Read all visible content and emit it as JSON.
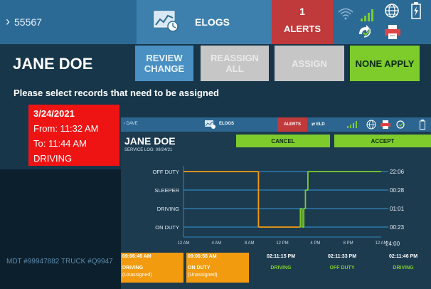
{
  "topbar": {
    "vehicle": "55567",
    "app_label": "ELOGS",
    "alerts_count": "1",
    "alerts_label": "ALERTS",
    "icons": [
      "wifi-icon",
      "signal-icon",
      "globe-icon",
      "battery-icon",
      "sync-icon",
      "printer-icon"
    ]
  },
  "main": {
    "driver_name": "JANE DOE",
    "buttons": {
      "review_line1": "REVIEW",
      "review_line2": "CHANGE",
      "reassign_all": "REASSIGN ALL",
      "assign": "ASSIGN",
      "none_apply": "NONE APPLY"
    },
    "instruction": "Please select records that need to be assigned",
    "record": {
      "date": "3/24/2021",
      "from": "From: 11:32 AM",
      "to": "To: 11:44 AM",
      "status": "DRIVING"
    },
    "footer": "MDT #99947882    TRUCK #Q9947"
  },
  "overlay": {
    "vehicle": "DAVE",
    "app_label": "ELOGS",
    "alerts_label": "ALERTS",
    "eld_label": "ELD",
    "driver_name": "JANE DOE",
    "service_log": "SERVICE LOG: 09/24/21",
    "cancel": "CANCEL",
    "accept": "ACCEPT",
    "records": [
      {
        "time": "09:06:46 AM",
        "status": "DRIVING",
        "sub": "(Unassigned)",
        "assigned": true
      },
      {
        "time": "09:06:56 AM",
        "status": "ON DUTY",
        "sub": "(Unassigned)",
        "assigned": true
      },
      {
        "time": "02:11:15 PM",
        "status": "DRIVING",
        "sub": "",
        "assigned": false
      },
      {
        "time": "02:11:33 PM",
        "status": "OFF DUTY",
        "sub": "",
        "assigned": false
      },
      {
        "time": "02:11:46 PM",
        "status": "DRIVING",
        "sub": "",
        "assigned": false
      }
    ]
  },
  "chart_data": {
    "type": "line",
    "title": "",
    "xlabel": "",
    "ylabel": "",
    "rows": [
      "OFF DUTY",
      "SLEEPER",
      "DRIVING",
      "ON DUTY"
    ],
    "row_totals": [
      "22:06",
      "00:28",
      "01:01",
      "00:23"
    ],
    "total": "24:00",
    "x_ticks": [
      "12 AM",
      "4 AM",
      "8 AM",
      "12 PM",
      "4 PM",
      "8 PM",
      "12 AM"
    ],
    "xlim_hours": [
      0,
      24
    ],
    "series": [
      {
        "color": "#f39b0f",
        "segments": [
          {
            "row": "OFF DUTY",
            "from": 0,
            "to": 9.1
          },
          {
            "row": "ON DUTY",
            "from": 9.1,
            "to": 14.19
          }
        ],
        "transitions": [
          9.1
        ]
      },
      {
        "color": "#7dcc2c",
        "segments": [
          {
            "row": "DRIVING",
            "from": 14.19,
            "to": 14.4
          },
          {
            "row": "ON DUTY",
            "from": 14.4,
            "to": 14.6
          },
          {
            "row": "DRIVING",
            "from": 14.6,
            "to": 14.8
          },
          {
            "row": "SLEEPER",
            "from": 14.8,
            "to": 15.1
          },
          {
            "row": "OFF DUTY",
            "from": 15.1,
            "to": 24
          }
        ],
        "transitions": [
          14.19,
          14.4,
          14.6,
          14.8,
          15.1
        ]
      }
    ]
  }
}
